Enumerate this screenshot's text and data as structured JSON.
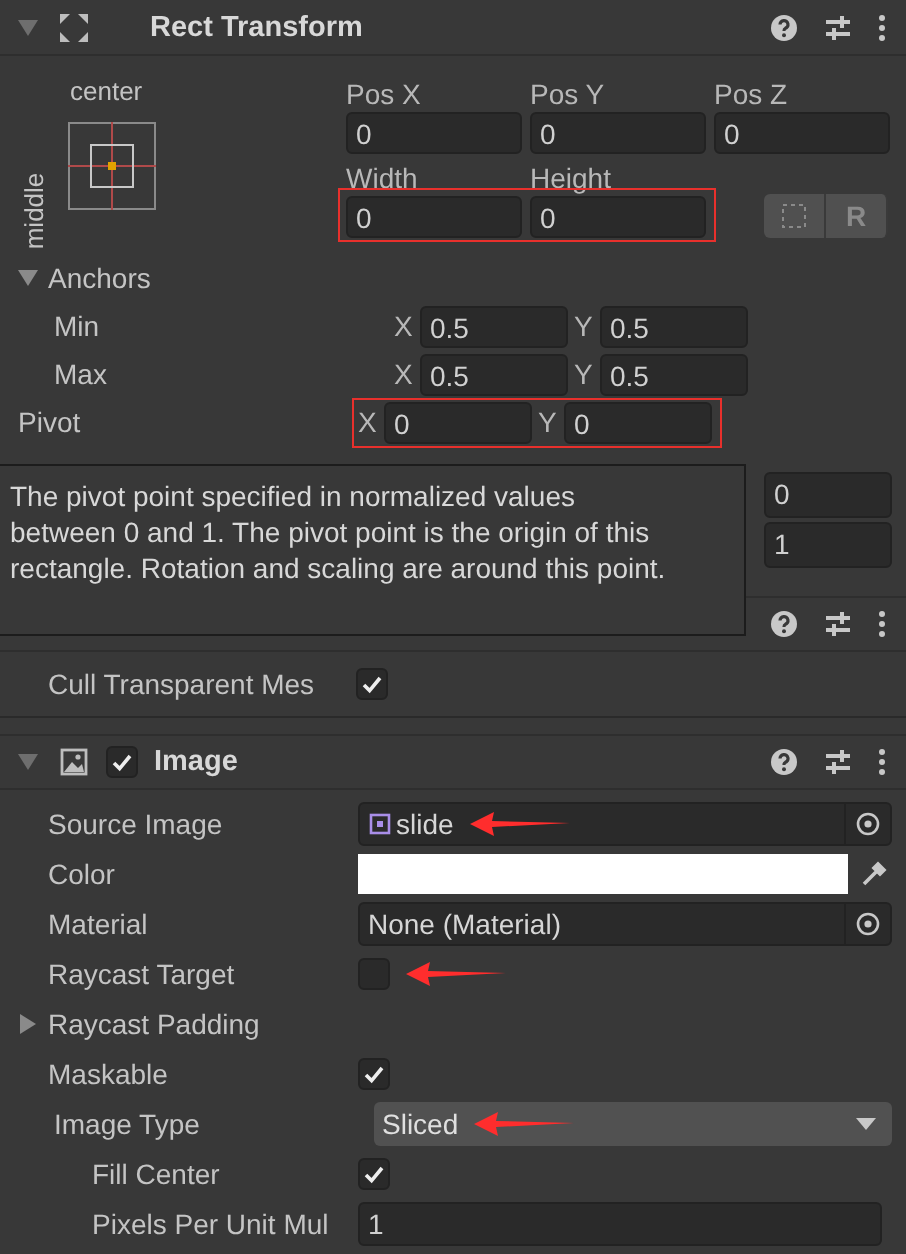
{
  "rect_transform": {
    "title": "Rect Transform",
    "expanded": true,
    "anchor_preset": {
      "horizontal": "center",
      "vertical": "middle"
    },
    "position_fields": [
      {
        "label": "Pos X",
        "value": "0"
      },
      {
        "label": "Pos Y",
        "value": "0"
      },
      {
        "label": "Pos Z",
        "value": "0"
      }
    ],
    "size_fields": {
      "highlighted": true,
      "fields": [
        {
          "label": "Width",
          "value": "0"
        },
        {
          "label": "Height",
          "value": "0"
        }
      ]
    },
    "raw_edit_button": "R",
    "anchors": {
      "label": "Anchors",
      "expanded": true,
      "rows": [
        {
          "label": "Min",
          "fields": [
            {
              "axis": "X",
              "value": "0.5"
            },
            {
              "axis": "Y",
              "value": "0.5"
            }
          ]
        },
        {
          "label": "Max",
          "fields": [
            {
              "axis": "X",
              "value": "0.5"
            },
            {
              "axis": "Y",
              "value": "0.5"
            }
          ]
        }
      ]
    },
    "pivot": {
      "label": "Pivot",
      "highlighted": true,
      "fields": [
        {
          "axis": "X",
          "value": "0"
        },
        {
          "axis": "Y",
          "value": "0"
        }
      ]
    }
  },
  "tooltip": "The pivot point specified in normalized values between 0 and 1. The pivot point is the origin of this rectangle. Rotation and scaling are around this point.",
  "covered_fields": [
    "0",
    "1"
  ],
  "canvas_renderer": {
    "cull_transparent_mesh": {
      "label": "Cull Transparent Mes",
      "checked": true
    }
  },
  "image": {
    "title": "Image",
    "enabled": true,
    "expanded": true,
    "properties": [
      {
        "kind": "object",
        "label": "Source Image",
        "value": "slide",
        "arrow": true
      },
      {
        "kind": "color",
        "label": "Color",
        "color": "#ffffff"
      },
      {
        "kind": "object",
        "label": "Material",
        "value": "None (Material)"
      },
      {
        "kind": "checkbox",
        "label": "Raycast Target",
        "checked": false,
        "arrow": true
      },
      {
        "kind": "foldout",
        "label": "Raycast Padding",
        "expanded": false
      },
      {
        "kind": "checkbox",
        "label": "Maskable",
        "checked": true
      },
      {
        "kind": "dropdown",
        "label": "Image Type",
        "value": "Sliced",
        "arrow": true,
        "children": [
          {
            "kind": "checkbox",
            "label": "Fill Center",
            "checked": true
          },
          {
            "kind": "number",
            "label": "Pixels Per Unit Mul",
            "value": "1"
          }
        ]
      }
    ]
  }
}
